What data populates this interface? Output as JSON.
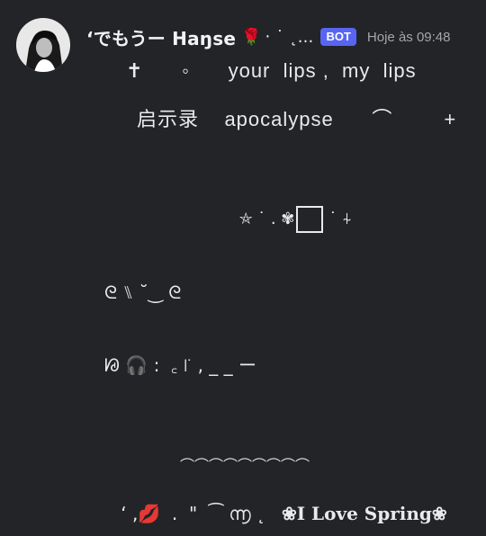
{
  "message": {
    "username": "‘でもうー Haŋse",
    "username_emoji": "🌹",
    "username_tail": "‧ ˙ ˛...",
    "bot_tag": "BOT",
    "timestamp": "Hoje às 09:48",
    "lines": [
      "✝      ◦      your  lips ,  my  lips",
      "启示录    apocalypse      ⌒        +",
      "⛤ ˙ . ✾",
      "ᘓ ⑊ ˘‿ ᘓ",
      "ᘘ 🎧 :  ꜀ ꜍ , _ _ ー",
      "⌒⌒⌒⌒⌒⌒⌒⌒⌒",
      "‘ ,",
      "💋",
      "  .  \"  ⁀ ൬ ˛",
      "❀I Love Spring❀"
    ],
    "line3_tail": "˙ ⍭"
  }
}
